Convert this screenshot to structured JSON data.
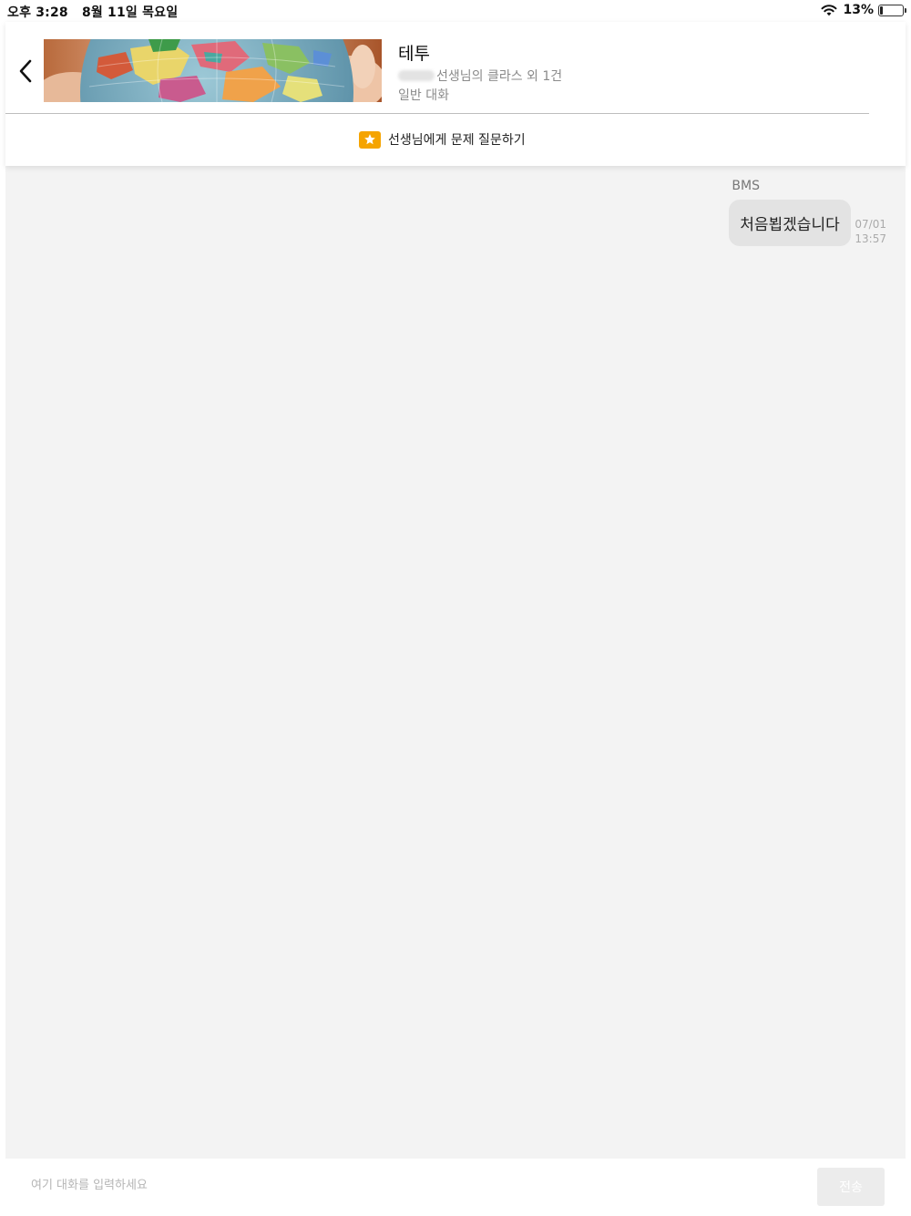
{
  "status_bar": {
    "time": "오후 3:28",
    "date": "8월 11일 목요일",
    "battery_percent_label": "13%",
    "battery_level": 0.13
  },
  "header": {
    "title": "테투",
    "subtitle": "선생님의 클라스 외 1건",
    "category": "일반 대화",
    "ask_question_label": "선생님에게 문제 질문하기",
    "accent_color": "#f5a400"
  },
  "chat": {
    "messages": [
      {
        "sender": "BMS",
        "text": "처음뵙겠습니다",
        "date": "07/01",
        "time": "13:57"
      }
    ]
  },
  "input": {
    "placeholder": "여기 대화를 입력하세요",
    "value": "",
    "send_label": "전송"
  },
  "icons": {
    "back": "chevron-left-icon",
    "star": "star-icon",
    "wifi": "wifi-icon",
    "battery": "battery-icon"
  }
}
